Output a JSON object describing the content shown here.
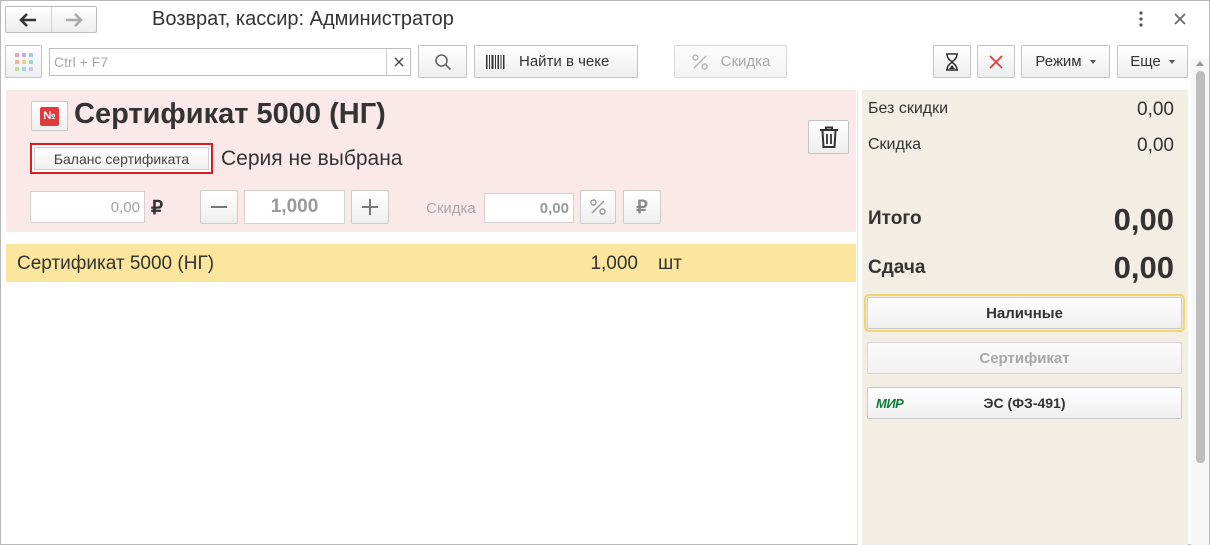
{
  "window": {
    "title": "Возврат, кассир: Администратор"
  },
  "toolbar": {
    "search_placeholder": "Ctrl + F7",
    "search_value": "",
    "find_in_receipt_label": "Найти в чеке",
    "discount_label": "Скидка",
    "mode_label": "Режим",
    "more_label": "Еще"
  },
  "card": {
    "title": "Сертификат 5000 (НГ)",
    "balance_button_label": "Баланс сертификата",
    "series_text": "Серия не выбрана",
    "price_value": "0,00",
    "currency_symbol": "₽",
    "quantity_value": "1,000",
    "discount_label": "Скидка",
    "discount_value": "0,00",
    "percent_symbol": "%",
    "ruble_symbol": "₽"
  },
  "items": [
    {
      "name": "Сертификат 5000 (НГ)",
      "qty": "1,000",
      "unit": "шт"
    }
  ],
  "summary": {
    "no_discount_label": "Без скидки",
    "no_discount_value": "0,00",
    "discount_label": "Скидка",
    "discount_value": "0,00",
    "total_label": "Итого",
    "total_value": "0,00",
    "change_label": "Сдача",
    "change_value": "0,00"
  },
  "payment": {
    "cash_label": "Наличные",
    "certificate_label": "Сертификат",
    "mir_logo_text": "МИР",
    "es_label": "ЭС (ФЗ-491)"
  },
  "colors": {
    "card_bg": "#fbe9e9",
    "selected_row": "#fce59c",
    "summary_bg": "#f2eee3",
    "highlight_border": "#d81e1e"
  }
}
